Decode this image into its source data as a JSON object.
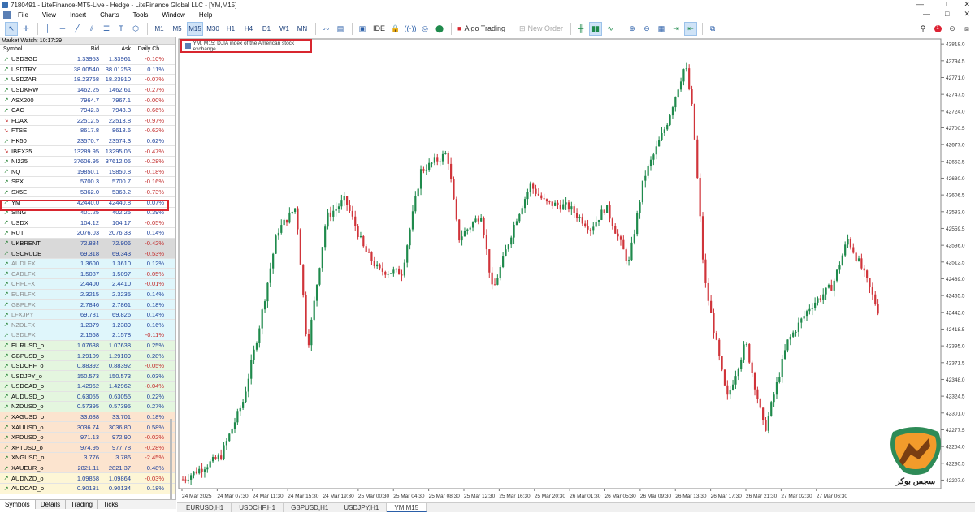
{
  "window": {
    "title": "7180491 - LiteFinance-MT5-Live - Hedge - LiteFinance Global LLC - [YM,M15]",
    "controls": [
      "—",
      "□",
      "✕"
    ]
  },
  "menu": [
    "File",
    "View",
    "Insert",
    "Charts",
    "Tools",
    "Window",
    "Help"
  ],
  "menu_controls": [
    "—",
    "□",
    "✕"
  ],
  "toolbar": {
    "timeframes": [
      "M1",
      "M5",
      "M15",
      "M30",
      "H1",
      "H4",
      "D1",
      "W1",
      "MN"
    ],
    "selected_timeframe": "M15",
    "ide_label": "IDE",
    "algo_label": "Algo Trading",
    "new_order_label": "New Order",
    "notification_count": "1"
  },
  "market_watch": {
    "header": "Market Watch: 10:17:29",
    "columns": {
      "symbol": "Symbol",
      "bid": "Bid",
      "ask": "Ask",
      "change": "Daily Ch..."
    },
    "rows": [
      {
        "symbol": "USDSGD",
        "bid": "1.33953",
        "ask": "1.33961",
        "change": "-0.10%",
        "dir": "up",
        "bg": "#ffffff"
      },
      {
        "symbol": "USDTRY",
        "bid": "38.00540",
        "ask": "38.01253",
        "change": "0.11%",
        "dir": "up",
        "bg": "#ffffff"
      },
      {
        "symbol": "USDZAR",
        "bid": "18.23768",
        "ask": "18.23910",
        "change": "-0.07%",
        "dir": "up",
        "bg": "#ffffff"
      },
      {
        "symbol": "USDKRW",
        "bid": "1462.25",
        "ask": "1462.61",
        "change": "-0.27%",
        "dir": "up",
        "bg": "#ffffff"
      },
      {
        "symbol": "ASX200",
        "bid": "7964.7",
        "ask": "7967.1",
        "change": "-0.00%",
        "dir": "up",
        "bg": "#ffffff"
      },
      {
        "symbol": "CAC",
        "bid": "7942.3",
        "ask": "7943.3",
        "change": "-0.66%",
        "dir": "up",
        "bg": "#ffffff"
      },
      {
        "symbol": "FDAX",
        "bid": "22512.5",
        "ask": "22513.8",
        "change": "-0.97%",
        "dir": "dn",
        "bg": "#ffffff"
      },
      {
        "symbol": "FTSE",
        "bid": "8617.8",
        "ask": "8618.6",
        "change": "-0.62%",
        "dir": "dn",
        "bg": "#ffffff"
      },
      {
        "symbol": "HK50",
        "bid": "23570.7",
        "ask": "23574.3",
        "change": "0.62%",
        "dir": "up",
        "bg": "#ffffff"
      },
      {
        "symbol": "IBEX35",
        "bid": "13289.95",
        "ask": "13295.05",
        "change": "-0.47%",
        "dir": "dn",
        "bg": "#ffffff"
      },
      {
        "symbol": "NI225",
        "bid": "37606.95",
        "ask": "37612.05",
        "change": "-0.28%",
        "dir": "up",
        "bg": "#ffffff"
      },
      {
        "symbol": "NQ",
        "bid": "19850.1",
        "ask": "19850.8",
        "change": "-0.18%",
        "dir": "up",
        "bg": "#ffffff"
      },
      {
        "symbol": "SPX",
        "bid": "5700.3",
        "ask": "5700.7",
        "change": "-0.16%",
        "dir": "up",
        "bg": "#ffffff"
      },
      {
        "symbol": "SX5E",
        "bid": "5362.0",
        "ask": "5363.2",
        "change": "-0.73%",
        "dir": "up",
        "bg": "#ffffff"
      },
      {
        "symbol": "YM",
        "bid": "42440.0",
        "ask": "42440.8",
        "change": "0.07%",
        "dir": "up",
        "bg": "#ffffff"
      },
      {
        "symbol": "SING",
        "bid": "401.25",
        "ask": "402.25",
        "change": "0.39%",
        "dir": "up",
        "bg": "#ffffff"
      },
      {
        "symbol": "USDX",
        "bid": "104.12",
        "ask": "104.17",
        "change": "-0.05%",
        "dir": "up",
        "bg": "#ffffff"
      },
      {
        "symbol": "RUT",
        "bid": "2076.03",
        "ask": "2076.33",
        "change": "0.14%",
        "dir": "up",
        "bg": "#ffffff"
      },
      {
        "symbol": "UKBRENT",
        "bid": "72.884",
        "ask": "72.906",
        "change": "-0.42%",
        "dir": "up",
        "bg": "#d9d9d9"
      },
      {
        "symbol": "USCRUDE",
        "bid": "69.318",
        "ask": "69.343",
        "change": "-0.53%",
        "dir": "up",
        "bg": "#d9d9d9"
      },
      {
        "symbol": "AUDLFX",
        "bid": "1.3600",
        "ask": "1.3610",
        "change": "0.12%",
        "dir": "up",
        "bg": "#dff6fb",
        "faint": true
      },
      {
        "symbol": "CADLFX",
        "bid": "1.5087",
        "ask": "1.5097",
        "change": "-0.05%",
        "dir": "up",
        "bg": "#dff6fb",
        "faint": true
      },
      {
        "symbol": "CHFLFX",
        "bid": "2.4400",
        "ask": "2.4410",
        "change": "-0.01%",
        "dir": "up",
        "bg": "#dff6fb",
        "faint": true
      },
      {
        "symbol": "EURLFX",
        "bid": "2.3215",
        "ask": "2.3235",
        "change": "0.14%",
        "dir": "up",
        "bg": "#dff6fb",
        "faint": true
      },
      {
        "symbol": "GBPLFX",
        "bid": "2.7846",
        "ask": "2.7861",
        "change": "0.18%",
        "dir": "up",
        "bg": "#dff6fb",
        "faint": true
      },
      {
        "symbol": "LFXJPY",
        "bid": "69.781",
        "ask": "69.826",
        "change": "0.14%",
        "dir": "up",
        "bg": "#dff6fb",
        "faint": true
      },
      {
        "symbol": "NZDLFX",
        "bid": "1.2379",
        "ask": "1.2389",
        "change": "0.16%",
        "dir": "up",
        "bg": "#dff6fb",
        "faint": true
      },
      {
        "symbol": "USDLFX",
        "bid": "2.1568",
        "ask": "2.1578",
        "change": "-0.11%",
        "dir": "up",
        "bg": "#dff6fb",
        "faint": true
      },
      {
        "symbol": "EURUSD_o",
        "bid": "1.07638",
        "ask": "1.07638",
        "change": "0.25%",
        "dir": "up",
        "bg": "#e4f6df"
      },
      {
        "symbol": "GBPUSD_o",
        "bid": "1.29109",
        "ask": "1.29109",
        "change": "0.28%",
        "dir": "up",
        "bg": "#e4f6df"
      },
      {
        "symbol": "USDCHF_o",
        "bid": "0.88392",
        "ask": "0.88392",
        "change": "-0.05%",
        "dir": "up",
        "bg": "#e4f6df"
      },
      {
        "symbol": "USDJPY_o",
        "bid": "150.573",
        "ask": "150.573",
        "change": "0.03%",
        "dir": "up",
        "bg": "#e4f6df"
      },
      {
        "symbol": "USDCAD_o",
        "bid": "1.42962",
        "ask": "1.42962",
        "change": "-0.04%",
        "dir": "up",
        "bg": "#e4f6df"
      },
      {
        "symbol": "AUDUSD_o",
        "bid": "0.63055",
        "ask": "0.63055",
        "change": "0.22%",
        "dir": "up",
        "bg": "#e4f6df"
      },
      {
        "symbol": "NZDUSD_o",
        "bid": "0.57395",
        "ask": "0.57395",
        "change": "0.27%",
        "dir": "up",
        "bg": "#e4f6df"
      },
      {
        "symbol": "XAGUSD_o",
        "bid": "33.688",
        "ask": "33.701",
        "change": "0.18%",
        "dir": "up",
        "bg": "#fce4cf"
      },
      {
        "symbol": "XAUUSD_o",
        "bid": "3036.74",
        "ask": "3036.80",
        "change": "0.58%",
        "dir": "up",
        "bg": "#fce4cf"
      },
      {
        "symbol": "XPDUSD_o",
        "bid": "971.13",
        "ask": "972.90",
        "change": "-0.02%",
        "dir": "up",
        "bg": "#fce4cf"
      },
      {
        "symbol": "XPTUSD_o",
        "bid": "974.95",
        "ask": "977.78",
        "change": "-0.28%",
        "dir": "up",
        "bg": "#fce4cf"
      },
      {
        "symbol": "XNGUSD_o",
        "bid": "3.776",
        "ask": "3.786",
        "change": "-2.45%",
        "dir": "up",
        "bg": "#fce4cf"
      },
      {
        "symbol": "XAUEUR_o",
        "bid": "2821.11",
        "ask": "2821.37",
        "change": "0.48%",
        "dir": "up",
        "bg": "#fce4cf"
      },
      {
        "symbol": "AUDNZD_o",
        "bid": "1.09858",
        "ask": "1.09864",
        "change": "-0.03%",
        "dir": "up",
        "bg": "#fdf6d6"
      },
      {
        "symbol": "AUDCAD_o",
        "bid": "0.90131",
        "ask": "0.90134",
        "change": "0.18%",
        "dir": "up",
        "bg": "#fdf6d6"
      }
    ],
    "tabs": [
      "Symbols",
      "Details",
      "Trading",
      "Ticks"
    ]
  },
  "chart": {
    "subtitle": "YM, M15:  DJIA index of the American stock exchange",
    "tabs": [
      "EURUSD,H1",
      "USDCHF,H1",
      "GBPUSD,H1",
      "USDJPY,H1",
      "YM,M15"
    ],
    "active_tab": "YM,M15",
    "up_color": "#1f8a4c",
    "down_color": "#d0343a",
    "watermark_text": "سجس بوكر"
  },
  "chart_data": {
    "type": "candlestick",
    "symbol": "YM",
    "timeframe": "M15",
    "ylim": [
      42195,
      42825
    ],
    "y_ticks": [
      "42818.0",
      "42794.5",
      "42771.0",
      "42747.5",
      "42724.0",
      "42700.5",
      "42677.0",
      "42653.5",
      "42630.0",
      "42606.5",
      "42583.0",
      "42559.5",
      "42536.0",
      "42512.5",
      "42489.0",
      "42465.5",
      "42442.0",
      "42418.5",
      "42395.0",
      "42371.5",
      "42348.0",
      "42324.5",
      "42301.0",
      "42277.5",
      "42254.0",
      "42230.5",
      "42207.0"
    ],
    "x_ticks": [
      "24 Mar 2025",
      "24 Mar 07:30",
      "24 Mar 11:30",
      "24 Mar 15:30",
      "24 Mar 19:30",
      "25 Mar 00:30",
      "25 Mar 04:30",
      "25 Mar 08:30",
      "25 Mar 12:30",
      "25 Mar 16:30",
      "25 Mar 20:30",
      "26 Mar 01:30",
      "26 Mar 05:30",
      "26 Mar 09:30",
      "26 Mar 13:30",
      "26 Mar 17:30",
      "26 Mar 21:30",
      "27 Mar 02:30",
      "27 Mar 06:30"
    ],
    "anchors": [
      {
        "x": 0,
        "y": 42208
      },
      {
        "x": 0.05,
        "y": 42240
      },
      {
        "x": 0.08,
        "y": 42318
      },
      {
        "x": 0.1,
        "y": 42415
      },
      {
        "x": 0.125,
        "y": 42555
      },
      {
        "x": 0.15,
        "y": 42590
      },
      {
        "x": 0.165,
        "y": 42390
      },
      {
        "x": 0.19,
        "y": 42575
      },
      {
        "x": 0.215,
        "y": 42600
      },
      {
        "x": 0.24,
        "y": 42530
      },
      {
        "x": 0.26,
        "y": 42500
      },
      {
        "x": 0.29,
        "y": 42498
      },
      {
        "x": 0.315,
        "y": 42640
      },
      {
        "x": 0.35,
        "y": 42665
      },
      {
        "x": 0.365,
        "y": 42545
      },
      {
        "x": 0.395,
        "y": 42580
      },
      {
        "x": 0.41,
        "y": 42470
      },
      {
        "x": 0.44,
        "y": 42570
      },
      {
        "x": 0.46,
        "y": 42620
      },
      {
        "x": 0.48,
        "y": 42595
      },
      {
        "x": 0.51,
        "y": 42590
      },
      {
        "x": 0.54,
        "y": 42560
      },
      {
        "x": 0.56,
        "y": 42590
      },
      {
        "x": 0.59,
        "y": 42510
      },
      {
        "x": 0.61,
        "y": 42630
      },
      {
        "x": 0.64,
        "y": 42705
      },
      {
        "x": 0.665,
        "y": 42790
      },
      {
        "x": 0.675,
        "y": 42720
      },
      {
        "x": 0.69,
        "y": 42490
      },
      {
        "x": 0.72,
        "y": 42320
      },
      {
        "x": 0.745,
        "y": 42400
      },
      {
        "x": 0.77,
        "y": 42275
      },
      {
        "x": 0.8,
        "y": 42400
      },
      {
        "x": 0.83,
        "y": 42450
      },
      {
        "x": 0.86,
        "y": 42480
      },
      {
        "x": 0.88,
        "y": 42545
      },
      {
        "x": 0.9,
        "y": 42500
      },
      {
        "x": 0.92,
        "y": 42445
      }
    ]
  }
}
